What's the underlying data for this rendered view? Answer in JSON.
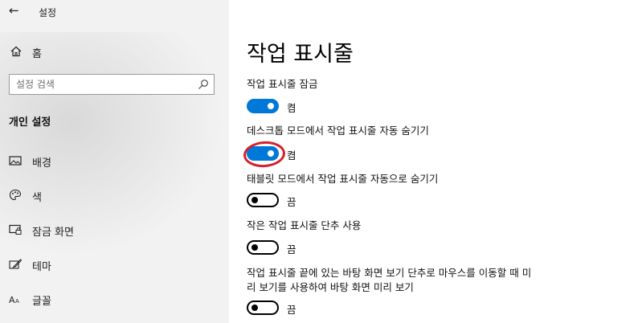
{
  "app": {
    "title": "설정"
  },
  "sidebar": {
    "home_label": "홈",
    "search_placeholder": "설정 검색",
    "section_title": "개인 설정",
    "items": [
      {
        "label": "배경",
        "icon": "picture-icon"
      },
      {
        "label": "색",
        "icon": "palette-icon"
      },
      {
        "label": "잠금 화면",
        "icon": "lock-screen-icon"
      },
      {
        "label": "테마",
        "icon": "theme-brush-icon"
      },
      {
        "label": "글꼴",
        "icon": "font-icon"
      }
    ]
  },
  "main": {
    "title": "작업 표시줄",
    "settings": [
      {
        "label": "작업 표시줄 잠금",
        "state": "켬",
        "on": true
      },
      {
        "label": "데스크톱 모드에서 작업 표시줄 자동 숨기기",
        "state": "켬",
        "on": true,
        "highlighted": true
      },
      {
        "label": "태블릿 모드에서 작업 표시줄 자동으로 숨기기",
        "state": "끔",
        "on": false
      },
      {
        "label": "작은 작업 표시줄 단추 사용",
        "state": "끔",
        "on": false
      },
      {
        "label_line1": "작업 표시줄 끝에 있는 바탕 화면 보기 단추로 마우스를 이동할 때 미",
        "label_line2": "리 보기를 사용하여 바탕 화면 미리 보기",
        "state": "끔",
        "on": false
      }
    ]
  },
  "colors": {
    "accent": "#0078d7",
    "highlight": "#d6202a",
    "sidebar_bg": "#f2f2f2"
  }
}
